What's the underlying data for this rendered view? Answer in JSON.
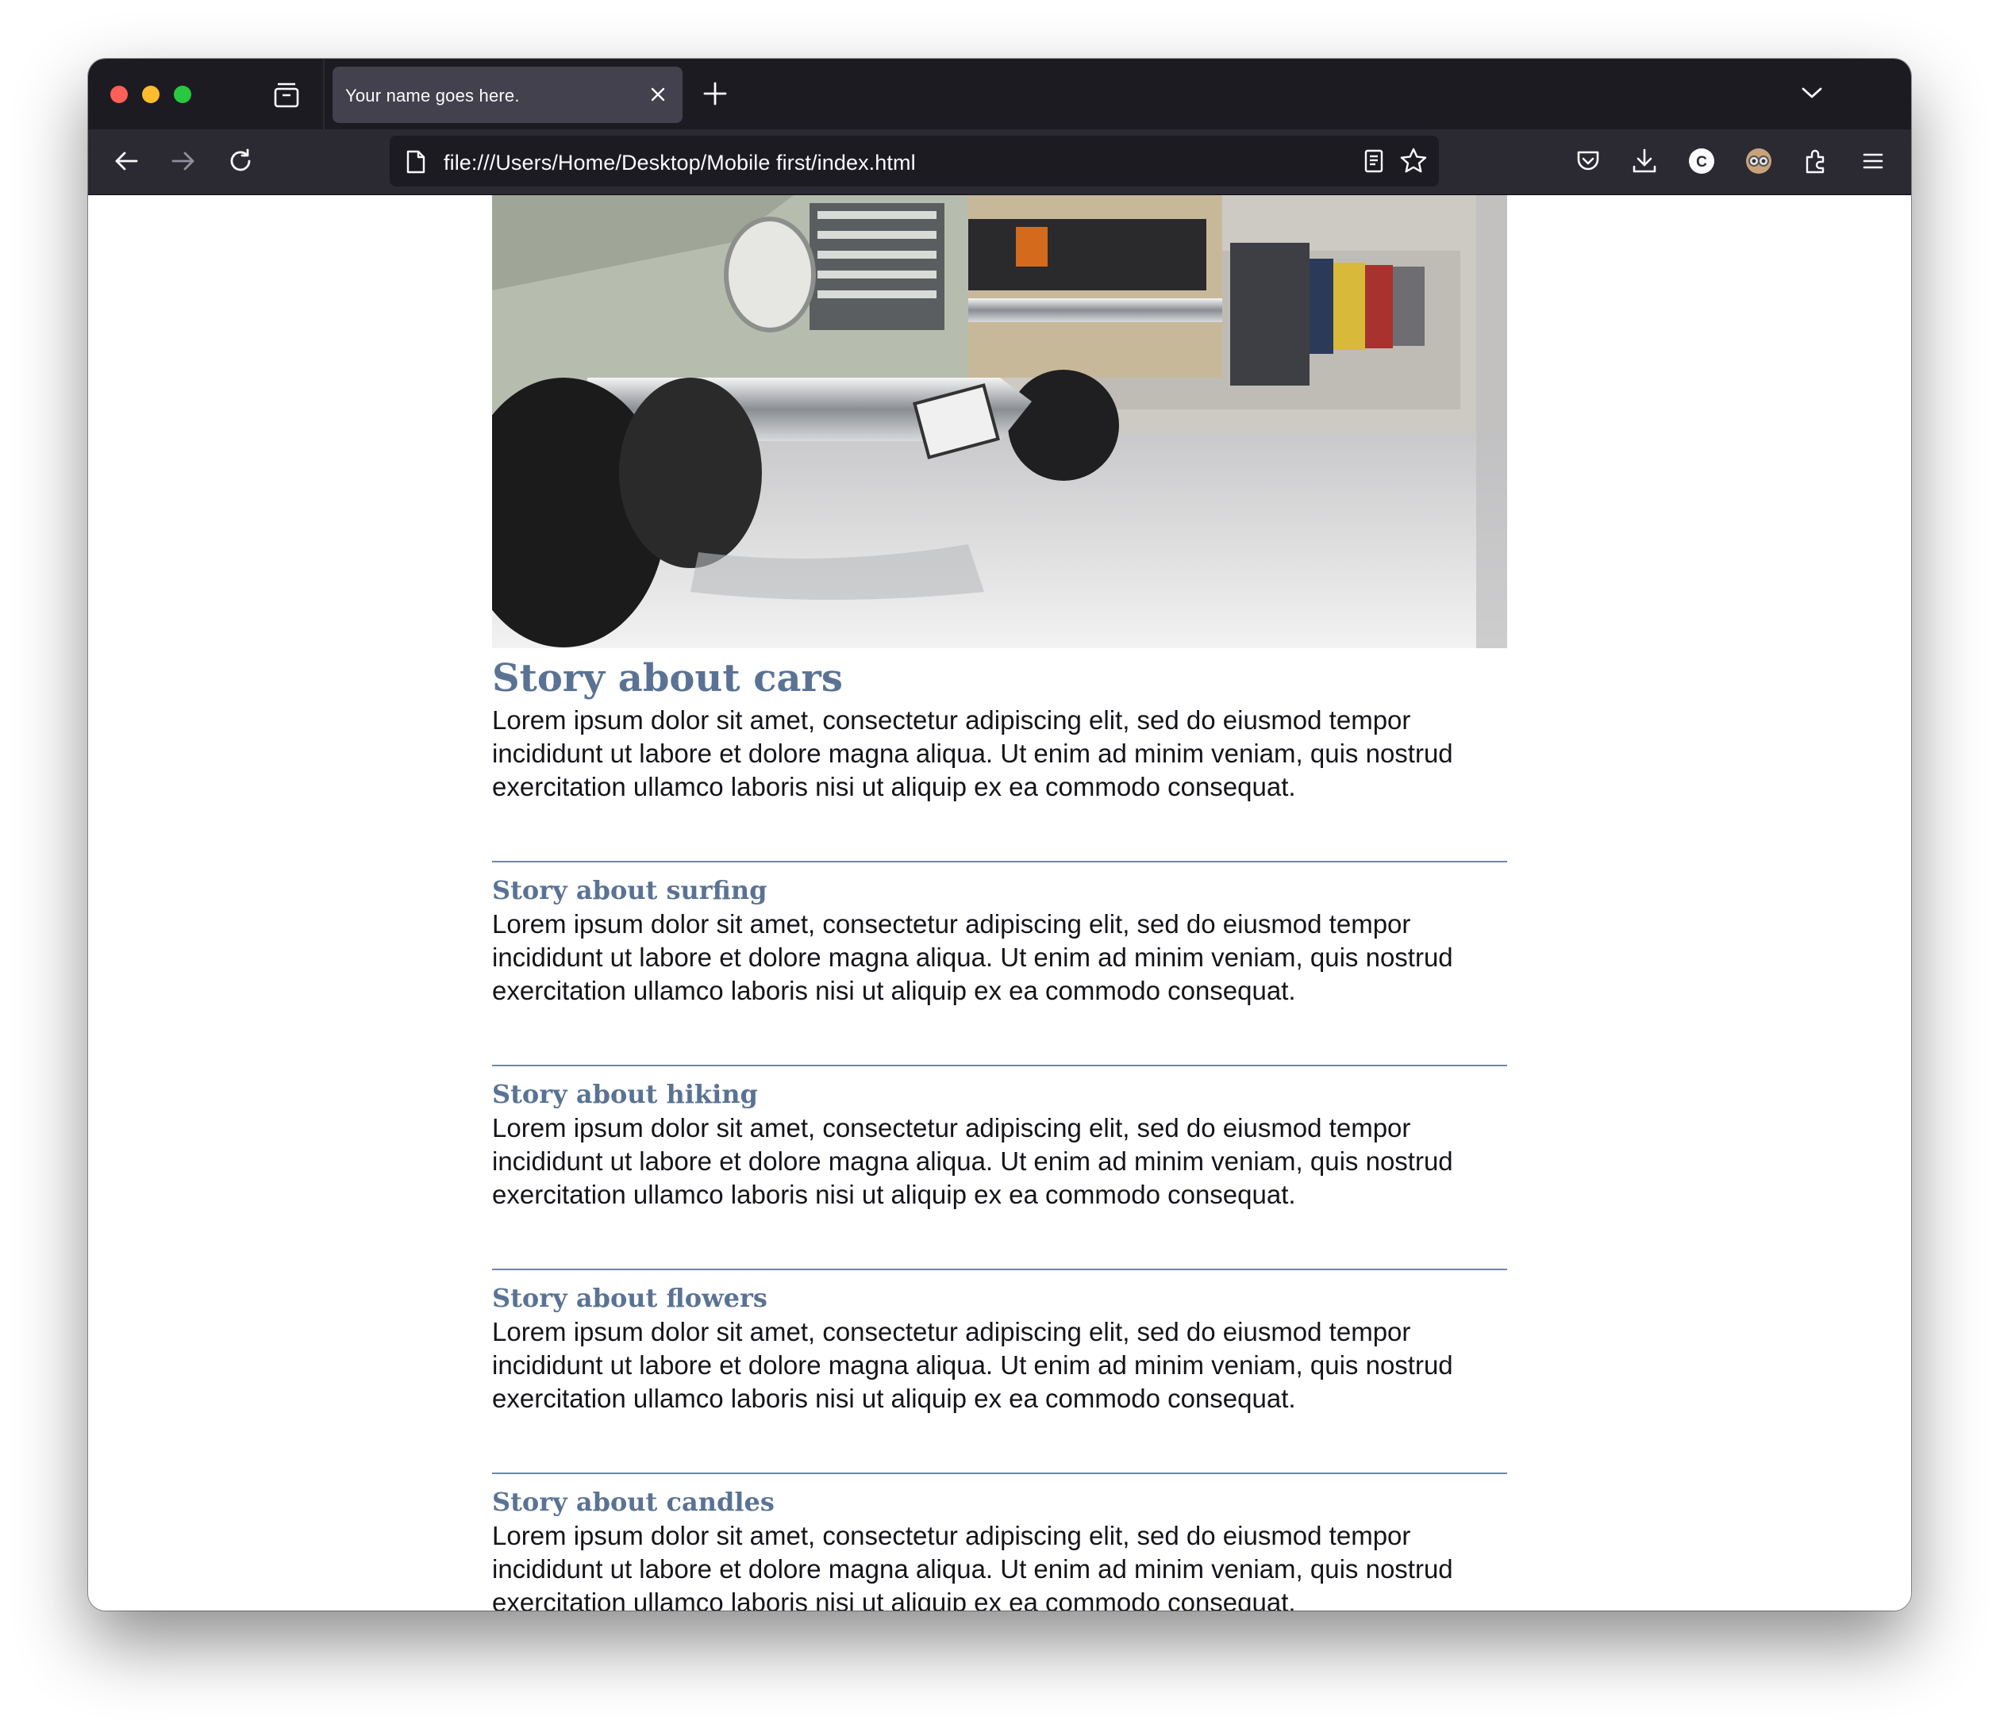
{
  "browser": {
    "tab_title": "Your name goes here.",
    "url": "file:///Users/Home/Desktop/Mobile first/index.html",
    "toolbar_icons": [
      "back-icon",
      "forward-icon",
      "reload-icon",
      "page-icon",
      "reader-view-icon",
      "bookmark-star-icon",
      "pocket-icon",
      "downloads-icon",
      "account-icon",
      "extension-avatar-icon",
      "extensions-icon",
      "menu-icon"
    ]
  },
  "page": {
    "hero_image_alt": "cars",
    "featured": {
      "title": "Story about cars",
      "text": "Lorem ipsum dolor sit amet, consectetur adipiscing elit, sed do eiusmod tempor incididunt ut labore et dolore magna aliqua. Ut enim ad minim veniam, quis nostrud exercitation ullamco laboris nisi ut aliquip ex ea commodo consequat."
    },
    "stories": [
      {
        "title": "Story about surfing",
        "text": "Lorem ipsum dolor sit amet, consectetur adipiscing elit, sed do eiusmod tempor incididunt ut labore et dolore magna aliqua. Ut enim ad minim veniam, quis nostrud exercitation ullamco laboris nisi ut aliquip ex ea commodo consequat."
      },
      {
        "title": "Story about hiking",
        "text": "Lorem ipsum dolor sit amet, consectetur adipiscing elit, sed do eiusmod tempor incididunt ut labore et dolore magna aliqua. Ut enim ad minim veniam, quis nostrud exercitation ullamco laboris nisi ut aliquip ex ea commodo consequat."
      },
      {
        "title": "Story about flowers",
        "text": "Lorem ipsum dolor sit amet, consectetur adipiscing elit, sed do eiusmod tempor incididunt ut labore et dolore magna aliqua. Ut enim ad minim veniam, quis nostrud exercitation ullamco laboris nisi ut aliquip ex ea commodo consequat."
      },
      {
        "title": "Story about candles",
        "text": "Lorem ipsum dolor sit amet, consectetur adipiscing elit, sed do eiusmod tempor incididunt ut labore et dolore magna aliqua. Ut enim ad minim veniam, quis nostrud exercitation ullamco laboris nisi ut aliquip ex ea commodo consequat."
      }
    ]
  },
  "colors": {
    "heading": "#5a7394",
    "separator": "#6f87a6",
    "body_text": "#15141a",
    "browser_chrome": "#1c1b22",
    "browser_toolbar": "#2b2a33"
  }
}
